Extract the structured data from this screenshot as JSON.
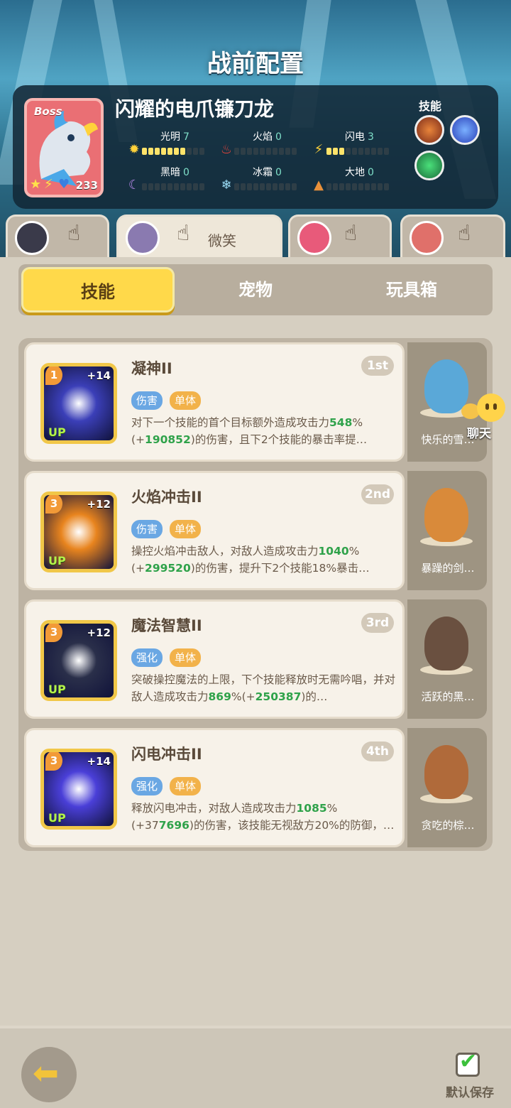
{
  "title": "战前配置",
  "boss": {
    "tag": "Boss",
    "name": "闪耀的电爪镰刀龙",
    "level": "233",
    "skills_label": "技能",
    "stats": [
      {
        "label": "光明",
        "value": "7",
        "fill": 7
      },
      {
        "label": "火焰",
        "value": "0",
        "fill": 0
      },
      {
        "label": "闪电",
        "value": "3",
        "fill": 3
      },
      {
        "label": "黑暗",
        "value": "0",
        "fill": 0
      },
      {
        "label": "冰霜",
        "value": "0",
        "fill": 0
      },
      {
        "label": "大地",
        "value": "0",
        "fill": 0
      }
    ]
  },
  "team_tabs": {
    "emote_label": "微笑"
  },
  "segments": [
    "技能",
    "宠物",
    "玩具箱"
  ],
  "cards": [
    {
      "name": "凝神II",
      "rank": "1st",
      "level": "1",
      "plus": "+14",
      "up": "UP",
      "tags": [
        "伤害",
        "单体"
      ],
      "desc_pre": "对下一个技能的首个目标额外造成攻击力",
      "desc_hl1": "548",
      "desc_mid": "%(+",
      "desc_hl2": "190852",
      "desc_post": ")的伤害，且下2个技能的暴击率提…",
      "pet_name": "快乐的雪…",
      "icon_color": "#3b3fb8",
      "pet_color": "#5aa8d8"
    },
    {
      "name": "火焰冲击II",
      "rank": "2nd",
      "level": "3",
      "plus": "+12",
      "up": "UP",
      "tags": [
        "伤害",
        "单体"
      ],
      "desc_pre": "操控火焰冲击敌人，对敌人造成攻击力",
      "desc_hl1": "1040",
      "desc_mid": "%(+",
      "desc_hl2": "299520",
      "desc_post": ")的伤害，提升下2个技能18%暴击…",
      "pet_name": "暴躁的剑…",
      "icon_color": "#e8841e",
      "pet_color": "#d98a3a"
    },
    {
      "name": "魔法智慧II",
      "rank": "3rd",
      "level": "3",
      "plus": "+12",
      "up": "UP",
      "tags": [
        "强化",
        "单体"
      ],
      "desc_pre": "突破操控魔法的上限，下个技能释放时无需吟唱，并对敌人造成攻击力",
      "desc_hl1": "869",
      "desc_mid": "%(+",
      "desc_hl2": "250387",
      "desc_post": ")的…",
      "pet_name": "活跃的黑…",
      "icon_color": "#2a2f4a",
      "pet_color": "#6a5040"
    },
    {
      "name": "闪电冲击II",
      "rank": "4th",
      "level": "3",
      "plus": "+14",
      "up": "UP",
      "tags": [
        "强化",
        "单体"
      ],
      "desc_pre": "释放闪电冲击，对敌人造成攻击力",
      "desc_hl1": "1085",
      "desc_mid": "%(+37",
      "desc_hl2": "7696",
      "desc_post": ")的伤害，该技能无视敌方20%的防御，…",
      "pet_name": "贪吃的棕…",
      "icon_color": "#4a3fd8",
      "pet_color": "#b06a3a"
    }
  ],
  "chat_label": "聊天",
  "save_label": "默认保存"
}
